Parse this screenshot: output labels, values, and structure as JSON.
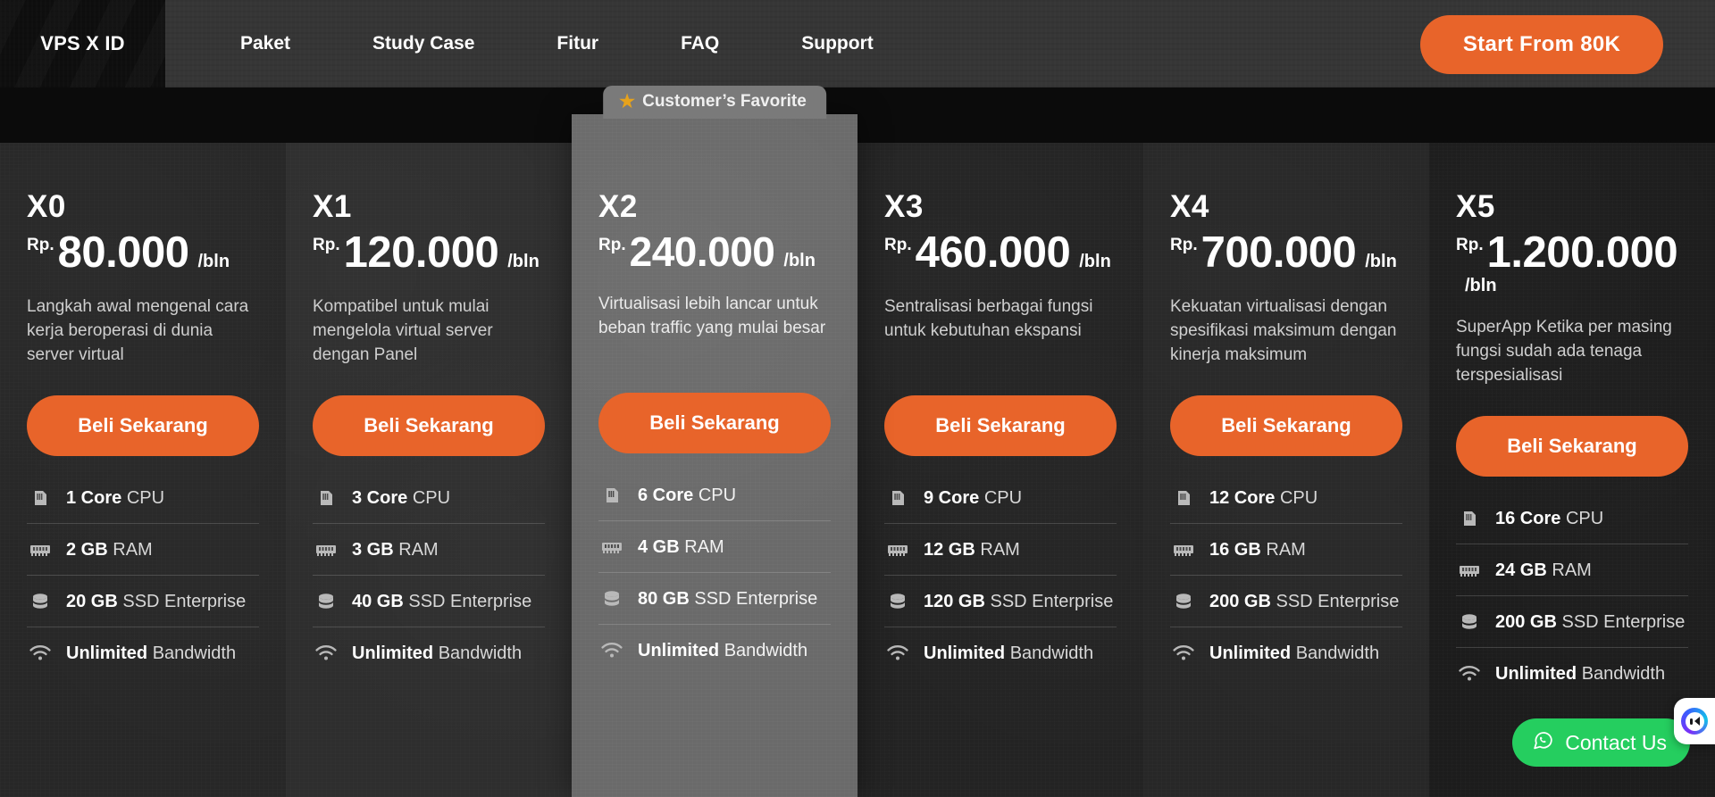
{
  "navbar": {
    "brand": "VPS X ID",
    "links": [
      {
        "label": "Paket"
      },
      {
        "label": "Study Case"
      },
      {
        "label": "Fitur"
      },
      {
        "label": "FAQ"
      },
      {
        "label": "Support"
      }
    ],
    "cta_label": "Start From 80K",
    "accent_color": "#e8642a",
    "bar_color": "#363636",
    "brand_block_color": "#0e0e0e"
  },
  "featured_badge": {
    "label": "Customer’s Favorite",
    "star_icon": "star-icon",
    "star_color": "#e6a21c",
    "badge_color": "#7a7a7a"
  },
  "plans": [
    {
      "name": "X0",
      "currency": "Rp.",
      "price": "80.000",
      "period": "/bln",
      "description": "Langkah awal mengenal cara kerja beroperasi di dunia server virtual",
      "buy_label": "Beli Sekarang",
      "featured": false,
      "specs": [
        {
          "icon": "cpu-icon",
          "value": "1 Core",
          "unit": "CPU"
        },
        {
          "icon": "ram-icon",
          "value": "2 GB",
          "unit": "RAM"
        },
        {
          "icon": "ssd-icon",
          "value": "20 GB",
          "unit": "SSD Enterprise"
        },
        {
          "icon": "bandwidth-icon",
          "value": "Unlimited",
          "unit": "Bandwidth"
        }
      ]
    },
    {
      "name": "X1",
      "currency": "Rp.",
      "price": "120.000",
      "period": "/bln",
      "description": "Kompatibel untuk mulai mengelola virtual server dengan Panel",
      "buy_label": "Beli Sekarang",
      "featured": false,
      "specs": [
        {
          "icon": "cpu-icon",
          "value": "3 Core",
          "unit": "CPU"
        },
        {
          "icon": "ram-icon",
          "value": "3 GB",
          "unit": "RAM"
        },
        {
          "icon": "ssd-icon",
          "value": "40 GB",
          "unit": "SSD Enterprise"
        },
        {
          "icon": "bandwidth-icon",
          "value": "Unlimited",
          "unit": "Bandwidth"
        }
      ]
    },
    {
      "name": "X2",
      "currency": "Rp.",
      "price": "240.000",
      "period": "/bln",
      "description": "Virtualisasi lebih lancar untuk beban traffic yang mulai besar",
      "buy_label": "Beli Sekarang",
      "featured": true,
      "specs": [
        {
          "icon": "cpu-icon",
          "value": "6 Core",
          "unit": "CPU"
        },
        {
          "icon": "ram-icon",
          "value": "4 GB",
          "unit": "RAM"
        },
        {
          "icon": "ssd-icon",
          "value": "80 GB",
          "unit": "SSD Enterprise"
        },
        {
          "icon": "bandwidth-icon",
          "value": "Unlimited",
          "unit": "Bandwidth"
        }
      ]
    },
    {
      "name": "X3",
      "currency": "Rp.",
      "price": "460.000",
      "period": "/bln",
      "description": "Sentralisasi berbagai fungsi untuk kebutuhan ekspansi",
      "buy_label": "Beli Sekarang",
      "featured": false,
      "specs": [
        {
          "icon": "cpu-icon",
          "value": "9 Core",
          "unit": "CPU"
        },
        {
          "icon": "ram-icon",
          "value": "12 GB",
          "unit": "RAM"
        },
        {
          "icon": "ssd-icon",
          "value": "120 GB",
          "unit": "SSD Enterprise"
        },
        {
          "icon": "bandwidth-icon",
          "value": "Unlimited",
          "unit": "Bandwidth"
        }
      ]
    },
    {
      "name": "X4",
      "currency": "Rp.",
      "price": "700.000",
      "period": "/bln",
      "description": "Kekuatan virtualisasi dengan spesifikasi maksimum dengan kinerja maksimum",
      "buy_label": "Beli Sekarang",
      "featured": false,
      "specs": [
        {
          "icon": "cpu-icon",
          "value": "12 Core",
          "unit": "CPU"
        },
        {
          "icon": "ram-icon",
          "value": "16 GB",
          "unit": "RAM"
        },
        {
          "icon": "ssd-icon",
          "value": "200 GB",
          "unit": "SSD Enterprise"
        },
        {
          "icon": "bandwidth-icon",
          "value": "Unlimited",
          "unit": "Bandwidth"
        }
      ]
    },
    {
      "name": "X5",
      "currency": "Rp.",
      "price": "1.200.000",
      "period": "/bln",
      "description": "SuperApp Ketika per masing fungsi sudah ada tenaga terspesialisasi",
      "buy_label": "Beli Sekarang",
      "featured": false,
      "specs": [
        {
          "icon": "cpu-icon",
          "value": "16 Core",
          "unit": "CPU"
        },
        {
          "icon": "ram-icon",
          "value": "24 GB",
          "unit": "RAM"
        },
        {
          "icon": "ssd-icon",
          "value": "200 GB",
          "unit": "SSD Enterprise"
        },
        {
          "icon": "bandwidth-icon",
          "value": "Unlimited",
          "unit": "Bandwidth"
        }
      ]
    }
  ],
  "floating": {
    "whatsapp_label": "Contact Us",
    "whatsapp_icon": "whatsapp-icon",
    "whatsapp_color": "#25ce5f",
    "chat_widget_icon": "chat-bubble-icon"
  }
}
